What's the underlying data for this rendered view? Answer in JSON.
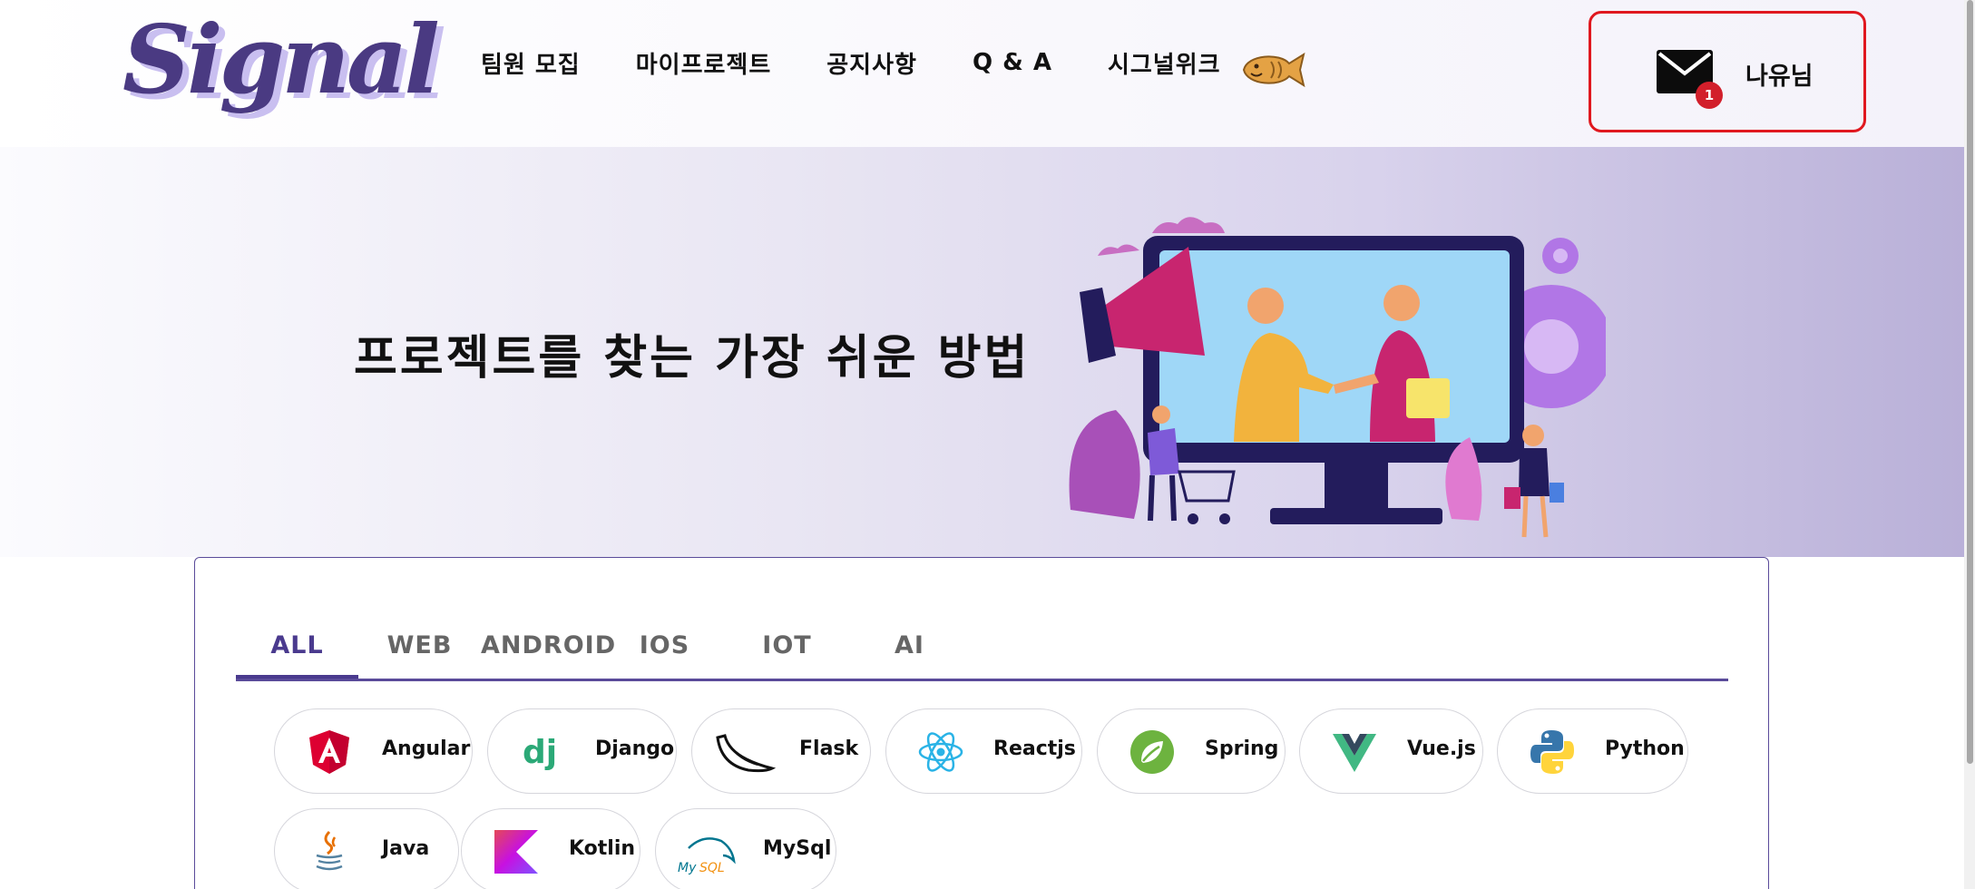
{
  "header": {
    "logo_text": "Signal",
    "nav": [
      "팀원 모집",
      "마이프로젝트",
      "공지사항",
      "Q & A",
      "시그널위크"
    ],
    "mascot_icon": "bungeoppang-icon",
    "user": {
      "name": "나유님",
      "mail_icon": "envelope-icon",
      "unread_count": "1",
      "highlight_color": "#e0181f"
    }
  },
  "hero": {
    "title": "프로젝트를 찾는 가장 쉬운 방법",
    "illustration": "handshake-monitor-illustration"
  },
  "tabs": [
    "ALL",
    "WEB",
    "ANDROID",
    "IOS",
    "IOT",
    "AI"
  ],
  "active_tab": "ALL",
  "stacks": [
    {
      "label": "Angular",
      "icon": "angular-icon"
    },
    {
      "label": "Django",
      "icon": "django-icon"
    },
    {
      "label": "Flask",
      "icon": "flask-icon"
    },
    {
      "label": "Reactjs",
      "icon": "react-icon"
    },
    {
      "label": "Spring",
      "icon": "spring-icon"
    },
    {
      "label": "Vue.js",
      "icon": "vue-icon"
    },
    {
      "label": "Python",
      "icon": "python-icon"
    },
    {
      "label": "Java",
      "icon": "java-icon"
    },
    {
      "label": "Kotlin",
      "icon": "kotlin-icon"
    },
    {
      "label": "MySql",
      "icon": "mysql-icon"
    }
  ],
  "colors": {
    "accent": "#4a3a8e",
    "logo": "#4a3a82"
  }
}
